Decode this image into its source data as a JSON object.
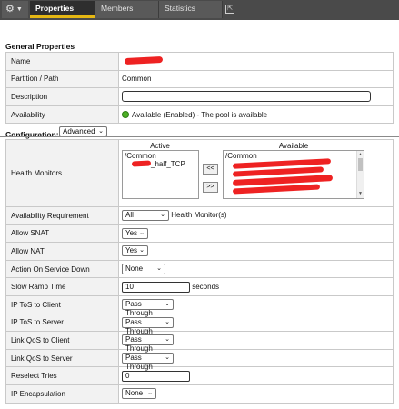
{
  "tabs": [
    "Properties",
    "Members",
    "Statistics"
  ],
  "icons": {
    "gear": "gear-icon",
    "external": "external-window-icon"
  },
  "accent_color": "#e5b713",
  "general": {
    "title": "General Properties",
    "rows": {
      "name": {
        "label": "Name"
      },
      "partition": {
        "label": "Partition / Path",
        "value": "Common"
      },
      "description": {
        "label": "Description",
        "value": ""
      },
      "availability": {
        "label": "Availability",
        "value": "Available (Enabled) - The pool is available",
        "status_color": "#4caf25"
      }
    }
  },
  "configuration": {
    "label": "Configuration:",
    "mode": "Advanced"
  },
  "health_monitors": {
    "label": "Health Monitors",
    "active_header": "Active",
    "available_header": "Available",
    "active_items": [
      "/Common",
      "_half_TCP"
    ],
    "available_items": [
      "/Common"
    ],
    "add_button": "<<",
    "remove_button": ">>"
  },
  "fields": {
    "availability_requirement": {
      "label": "Availability Requirement",
      "value": "All",
      "suffix": "Health Monitor(s)"
    },
    "allow_snat": {
      "label": "Allow SNAT",
      "value": "Yes"
    },
    "allow_nat": {
      "label": "Allow NAT",
      "value": "Yes"
    },
    "action_on_service_down": {
      "label": "Action On Service Down",
      "value": "None"
    },
    "slow_ramp_time": {
      "label": "Slow Ramp Time",
      "value": "10",
      "suffix": "seconds"
    },
    "ip_tos_to_client": {
      "label": "IP ToS to Client",
      "value": "Pass Through"
    },
    "ip_tos_to_server": {
      "label": "IP ToS to Server",
      "value": "Pass Through"
    },
    "link_qos_to_client": {
      "label": "Link QoS to Client",
      "value": "Pass Through"
    },
    "link_qos_to_server": {
      "label": "Link QoS to Server",
      "value": "Pass Through"
    },
    "reselect_tries": {
      "label": "Reselect Tries",
      "value": "0"
    },
    "ip_encapsulation": {
      "label": "IP Encapsulation",
      "value": "None"
    }
  }
}
